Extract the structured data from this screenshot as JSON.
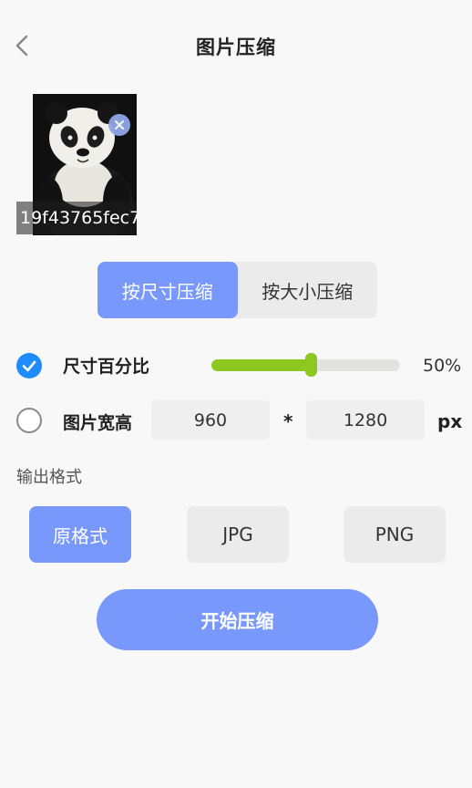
{
  "header": {
    "title": "图片压缩",
    "back_icon": "chevron-left-icon"
  },
  "image": {
    "file_name": "19f43765fec7",
    "remove_icon": "close-icon"
  },
  "tabs": [
    {
      "label": "按尺寸压缩",
      "active": true
    },
    {
      "label": "按大小压缩",
      "active": false
    }
  ],
  "options": {
    "percentage": {
      "label": "尺寸百分比",
      "checked": true,
      "value_label": "50%",
      "value": 50
    },
    "dimensions": {
      "label": "图片宽高",
      "checked": false,
      "width": "960",
      "height": "1280",
      "separator": "*",
      "unit": "px"
    }
  },
  "output_format": {
    "title": "输出格式",
    "options": [
      {
        "label": "原格式",
        "active": true
      },
      {
        "label": "JPG",
        "active": false
      },
      {
        "label": "PNG",
        "active": false
      }
    ]
  },
  "start_button": {
    "label": "开始压缩"
  },
  "colors": {
    "accent": "#7899fb",
    "radio_on": "#1e8cff",
    "slider": "#8cc820"
  }
}
